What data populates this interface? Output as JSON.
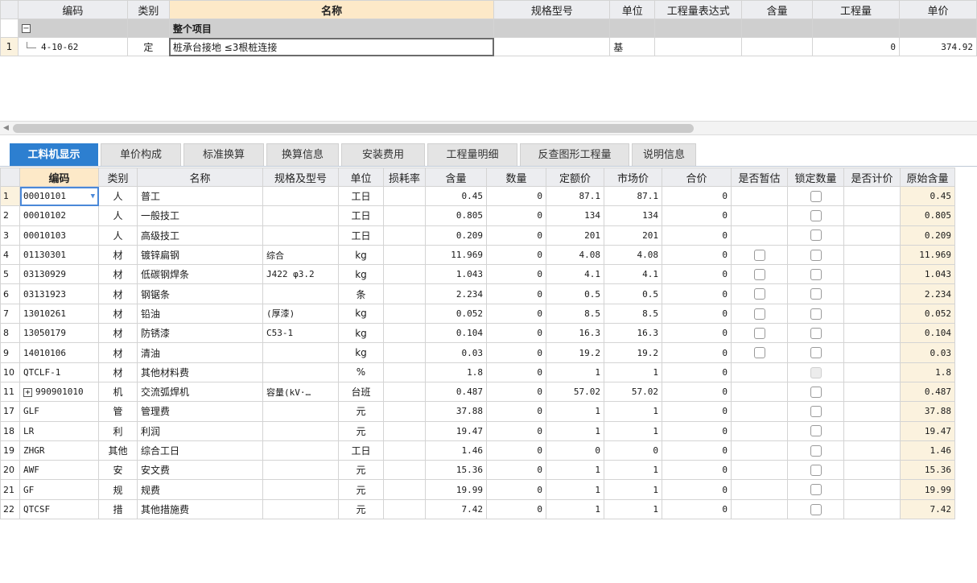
{
  "top_grid": {
    "headers": [
      "编码",
      "类别",
      "名称",
      "规格型号",
      "单位",
      "工程量表达式",
      "含量",
      "工程量",
      "单价"
    ],
    "group_row": {
      "toggle": "−",
      "name": "整个项目"
    },
    "rows": [
      {
        "num": "1",
        "code": "4-10-62",
        "type": "定",
        "name": "桩承台接地 ≤3根桩连接",
        "spec": "",
        "unit": "基",
        "expr": "",
        "content": "",
        "quantity": "0",
        "price": "374.92"
      }
    ]
  },
  "scrollbar": {
    "arrow": "◀"
  },
  "tabs": [
    "工料机显示",
    "单价构成",
    "标准换算",
    "换算信息",
    "安装费用",
    "工程量明细",
    "反查图形工程量",
    "说明信息"
  ],
  "bottom_grid": {
    "headers": [
      "编码",
      "类别",
      "名称",
      "规格及型号",
      "单位",
      "损耗率",
      "含量",
      "数量",
      "定额价",
      "市场价",
      "合价",
      "是否暂估",
      "锁定数量",
      "是否计价",
      "原始含量"
    ],
    "rows": [
      {
        "num": "1",
        "code": "00010101",
        "type": "人",
        "name": "普工",
        "spec": "",
        "unit": "工日",
        "loss": "",
        "content": "0.45",
        "qty": "0",
        "quota": "87.1",
        "market": "87.1",
        "total": "0",
        "est": false,
        "lock": true,
        "orig": "0.45"
      },
      {
        "num": "2",
        "code": "00010102",
        "type": "人",
        "name": "一般技工",
        "spec": "",
        "unit": "工日",
        "loss": "",
        "content": "0.805",
        "qty": "0",
        "quota": "134",
        "market": "134",
        "total": "0",
        "est": false,
        "lock": true,
        "orig": "0.805"
      },
      {
        "num": "3",
        "code": "00010103",
        "type": "人",
        "name": "高级技工",
        "spec": "",
        "unit": "工日",
        "loss": "",
        "content": "0.209",
        "qty": "0",
        "quota": "201",
        "market": "201",
        "total": "0",
        "est": false,
        "lock": true,
        "orig": "0.209"
      },
      {
        "num": "4",
        "code": "01130301",
        "type": "材",
        "name": "镀锌扁钢",
        "spec": "综合",
        "unit": "kg",
        "loss": "",
        "content": "11.969",
        "qty": "0",
        "quota": "4.08",
        "market": "4.08",
        "total": "0",
        "est": true,
        "lock": true,
        "orig": "11.969"
      },
      {
        "num": "5",
        "code": "03130929",
        "type": "材",
        "name": "低碳钢焊条",
        "spec": "J422 φ3.2",
        "unit": "kg",
        "loss": "",
        "content": "1.043",
        "qty": "0",
        "quota": "4.1",
        "market": "4.1",
        "total": "0",
        "est": true,
        "lock": true,
        "orig": "1.043"
      },
      {
        "num": "6",
        "code": "03131923",
        "type": "材",
        "name": "钢锯条",
        "spec": "",
        "unit": "条",
        "loss": "",
        "content": "2.234",
        "qty": "0",
        "quota": "0.5",
        "market": "0.5",
        "total": "0",
        "est": true,
        "lock": true,
        "orig": "2.234"
      },
      {
        "num": "7",
        "code": "13010261",
        "type": "材",
        "name": "铅油",
        "spec": "(厚漆)",
        "unit": "kg",
        "loss": "",
        "content": "0.052",
        "qty": "0",
        "quota": "8.5",
        "market": "8.5",
        "total": "0",
        "est": true,
        "lock": true,
        "orig": "0.052"
      },
      {
        "num": "8",
        "code": "13050179",
        "type": "材",
        "name": "防锈漆",
        "spec": "C53-1",
        "unit": "kg",
        "loss": "",
        "content": "0.104",
        "qty": "0",
        "quota": "16.3",
        "market": "16.3",
        "total": "0",
        "est": true,
        "lock": true,
        "orig": "0.104"
      },
      {
        "num": "9",
        "code": "14010106",
        "type": "材",
        "name": "清油",
        "spec": "",
        "unit": "kg",
        "loss": "",
        "content": "0.03",
        "qty": "0",
        "quota": "19.2",
        "market": "19.2",
        "total": "0",
        "est": true,
        "lock": true,
        "orig": "0.03"
      },
      {
        "num": "10",
        "code": "QTCLF-1",
        "type": "材",
        "name": "其他材料费",
        "spec": "",
        "unit": "%",
        "loss": "",
        "content": "1.8",
        "qty": "0",
        "quota": "1",
        "market": "1",
        "total": "0",
        "est": false,
        "lock": "disabled",
        "orig": "1.8"
      },
      {
        "num": "11",
        "code": "990901010",
        "type": "机",
        "name": "交流弧焊机",
        "spec": "容量(kV·…",
        "unit": "台班",
        "loss": "",
        "content": "0.487",
        "qty": "0",
        "quota": "57.02",
        "market": "57.02",
        "total": "0",
        "est": false,
        "lock": true,
        "orig": "0.487",
        "expand": "+"
      },
      {
        "num": "17",
        "code": "GLF",
        "type": "管",
        "name": "管理费",
        "spec": "",
        "unit": "元",
        "loss": "",
        "content": "37.88",
        "qty": "0",
        "quota": "1",
        "market": "1",
        "total": "0",
        "est": false,
        "lock": true,
        "orig": "37.88"
      },
      {
        "num": "18",
        "code": "LR",
        "type": "利",
        "name": "利润",
        "spec": "",
        "unit": "元",
        "loss": "",
        "content": "19.47",
        "qty": "0",
        "quota": "1",
        "market": "1",
        "total": "0",
        "est": false,
        "lock": true,
        "orig": "19.47"
      },
      {
        "num": "19",
        "code": "ZHGR",
        "type": "其他",
        "name": "综合工日",
        "spec": "",
        "unit": "工日",
        "loss": "",
        "content": "1.46",
        "qty": "0",
        "quota": "0",
        "market": "0",
        "total": "0",
        "est": false,
        "lock": true,
        "orig": "1.46"
      },
      {
        "num": "20",
        "code": "AWF",
        "type": "安",
        "name": "安文费",
        "spec": "",
        "unit": "元",
        "loss": "",
        "content": "15.36",
        "qty": "0",
        "quota": "1",
        "market": "1",
        "total": "0",
        "est": false,
        "lock": true,
        "orig": "15.36"
      },
      {
        "num": "21",
        "code": "GF",
        "type": "规",
        "name": "规费",
        "spec": "",
        "unit": "元",
        "loss": "",
        "content": "19.99",
        "qty": "0",
        "quota": "1",
        "market": "1",
        "total": "0",
        "est": false,
        "lock": true,
        "orig": "19.99"
      },
      {
        "num": "22",
        "code": "QTCSF",
        "type": "措",
        "name": "其他措施费",
        "spec": "",
        "unit": "元",
        "loss": "",
        "content": "7.42",
        "qty": "0",
        "quota": "1",
        "market": "1",
        "total": "0",
        "est": false,
        "lock": true,
        "orig": "7.42"
      }
    ]
  }
}
